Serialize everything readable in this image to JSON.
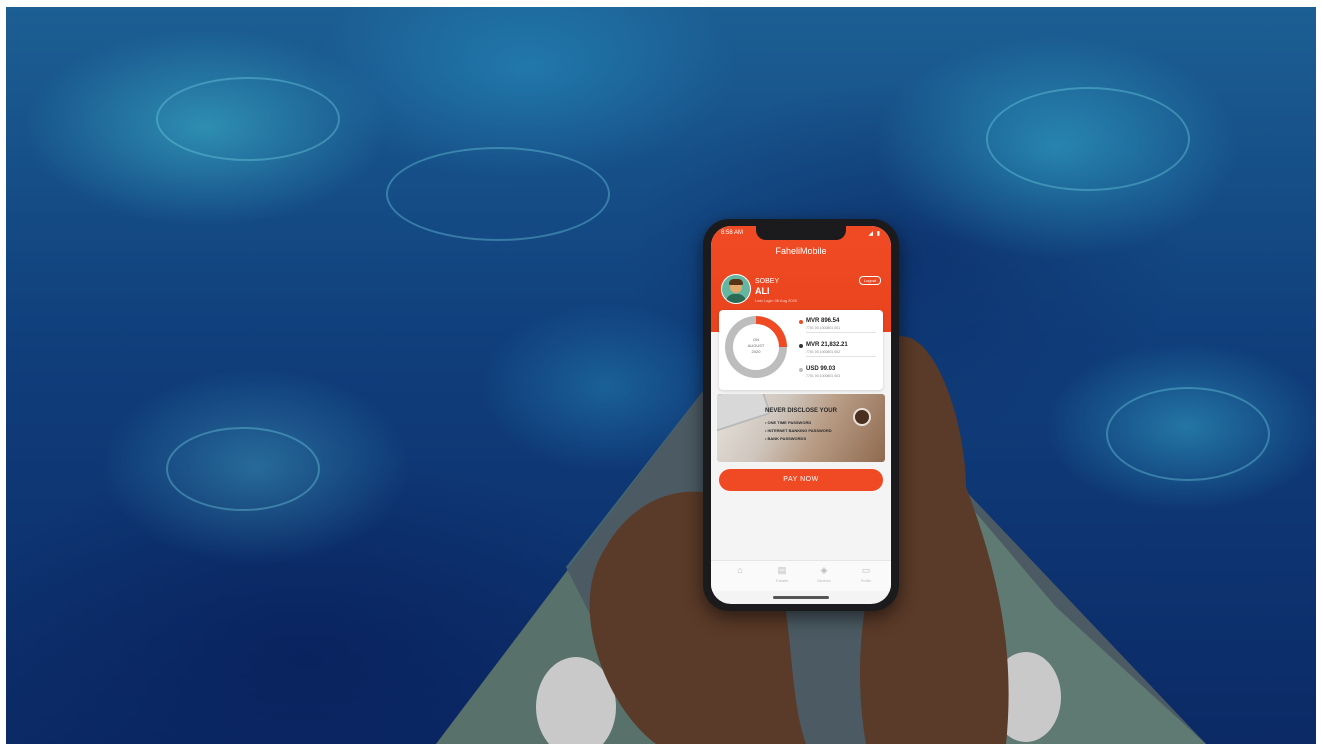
{
  "app": {
    "title": "FaheliMobile"
  },
  "status_bar": {
    "time": "8:58 AM",
    "icons": "◢ ▮"
  },
  "user": {
    "first_name": "SOBEY",
    "last_name": "ALI",
    "subtitle": "Last Login 06 Aug 2020",
    "action_label": "Logout"
  },
  "summary": {
    "lines": [
      "ON",
      "AUGUST",
      "2020"
    ]
  },
  "accounts": [
    {
      "amount": "MVR 896.54",
      "detail": "7701 00 1000801 001",
      "dot_color": "#ef4a23"
    },
    {
      "amount": "MVR 21,832.21",
      "detail": "7701 00 1000801 002",
      "dot_color": "#333333"
    },
    {
      "amount": "USD 99.03",
      "detail": "7701 00 1000801 003",
      "dot_color": "#bdbdbd"
    }
  ],
  "banner": {
    "title": "NEVER DISCLOSE YOUR",
    "items": [
      "• ONE TIME PASSWORD",
      "• INTERNET BANKING PASSWORD",
      "• BANK PASSWORDS"
    ]
  },
  "primary_action": {
    "label": "PAY NOW"
  },
  "tabs": [
    {
      "icon": "home-icon",
      "glyph": "⌂",
      "label": ""
    },
    {
      "icon": "card-icon",
      "glyph": "▤",
      "label": "Transfer"
    },
    {
      "icon": "tag-icon",
      "glyph": "◈",
      "label": "Services"
    },
    {
      "icon": "wallet-icon",
      "glyph": "▭",
      "label": "Profile"
    }
  ],
  "colors": {
    "brand": "#ef4a23",
    "water": "#103f7c"
  }
}
